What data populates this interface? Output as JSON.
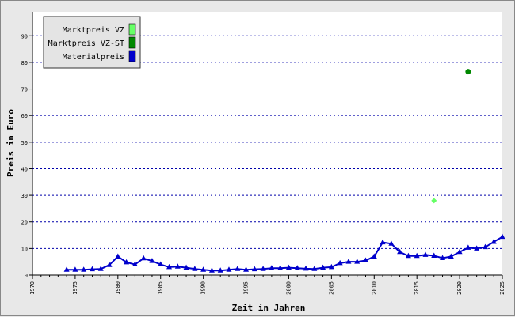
{
  "chart_data": {
    "type": "line",
    "xlabel": "Zeit in Jahren",
    "ylabel": "Preis in Euro",
    "xlim": [
      1970,
      2025
    ],
    "ylim": [
      0,
      99
    ],
    "x_ticks": [
      1970,
      1975,
      1980,
      1985,
      1990,
      1995,
      2000,
      2005,
      2010,
      2015,
      2020,
      2025
    ],
    "y_ticks": [
      0,
      10,
      20,
      30,
      40,
      50,
      60,
      70,
      80,
      90
    ],
    "grid": "horizontal dotted",
    "legend_position": "top-left",
    "series": [
      {
        "name": "Marktpreis VZ",
        "type": "scatter",
        "marker": "diamond",
        "color": "#66ff66",
        "points": [
          [
            2017,
            28
          ]
        ]
      },
      {
        "name": "Marktpreis VZ-ST",
        "type": "scatter",
        "marker": "circle",
        "color": "#008800",
        "points": [
          [
            2021,
            76.5
          ]
        ]
      },
      {
        "name": "Materialpreis",
        "type": "line",
        "marker": "triangle",
        "color": "#0000cc",
        "points": [
          [
            1974,
            2.0
          ],
          [
            1975,
            2.0
          ],
          [
            1976,
            2.0
          ],
          [
            1977,
            2.2
          ],
          [
            1978,
            2.3
          ],
          [
            1979,
            3.8
          ],
          [
            1980,
            7.0
          ],
          [
            1981,
            4.8
          ],
          [
            1982,
            4.0
          ],
          [
            1983,
            6.3
          ],
          [
            1984,
            5.3
          ],
          [
            1985,
            4.0
          ],
          [
            1986,
            3.0
          ],
          [
            1987,
            3.2
          ],
          [
            1988,
            2.8
          ],
          [
            1989,
            2.3
          ],
          [
            1990,
            2.0
          ],
          [
            1991,
            1.7
          ],
          [
            1992,
            1.7
          ],
          [
            1993,
            2.0
          ],
          [
            1994,
            2.3
          ],
          [
            1995,
            2.0
          ],
          [
            1996,
            2.2
          ],
          [
            1997,
            2.3
          ],
          [
            1998,
            2.6
          ],
          [
            1999,
            2.6
          ],
          [
            2000,
            2.8
          ],
          [
            2001,
            2.6
          ],
          [
            2002,
            2.4
          ],
          [
            2003,
            2.3
          ],
          [
            2004,
            2.8
          ],
          [
            2005,
            3.0
          ],
          [
            2006,
            4.5
          ],
          [
            2007,
            5.0
          ],
          [
            2008,
            5.0
          ],
          [
            2009,
            5.5
          ],
          [
            2010,
            7.0
          ],
          [
            2011,
            12.3
          ],
          [
            2012,
            11.8
          ],
          [
            2013,
            8.7
          ],
          [
            2014,
            7.2
          ],
          [
            2015,
            7.2
          ],
          [
            2016,
            7.6
          ],
          [
            2017,
            7.3
          ],
          [
            2018,
            6.4
          ],
          [
            2019,
            7.0
          ],
          [
            2020,
            8.7
          ],
          [
            2021,
            10.3
          ],
          [
            2022,
            10.0
          ],
          [
            2023,
            10.5
          ],
          [
            2024,
            12.5
          ],
          [
            2025,
            14.4
          ]
        ]
      }
    ]
  }
}
